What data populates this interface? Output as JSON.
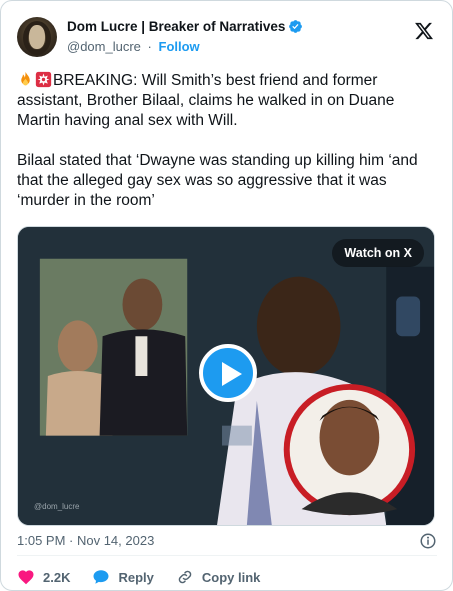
{
  "author": {
    "display_name": "Dom Lucre | Breaker of Narratives",
    "handle": "@dom_lucre",
    "separator": "·",
    "follow_label": "Follow"
  },
  "tweet": {
    "paragraph1": "BREAKING: Will Smith’s best friend and former assistant, Brother Bilaal, claims he walked in on Duane Martin having anal sex with Will.",
    "paragraph2": "Bilaal stated that ‘Dwayne was standing up killing him ‘and that the alleged gay sex was so aggressive that it was ‘murder in the room’",
    "leading_emojis": [
      "fire-icon",
      "siren-icon"
    ]
  },
  "media": {
    "watch_label": "Watch on X",
    "watermark": "@dom_lucre"
  },
  "meta": {
    "timestamp": "1:05 PM · Nov 14, 2023"
  },
  "actions": {
    "like_count": "2.2K",
    "reply_label": "Reply",
    "copy_label": "Copy link"
  },
  "colors": {
    "accent": "#1d9bf0",
    "like_red": "#f91880",
    "text_primary": "#0f1419",
    "text_secondary": "#536471"
  }
}
